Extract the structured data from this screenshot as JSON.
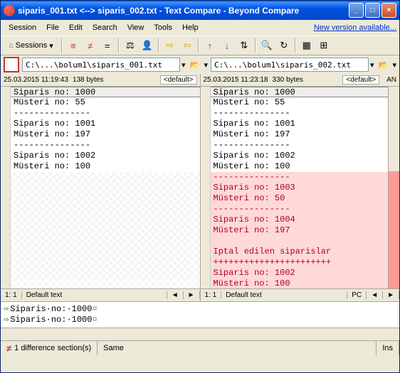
{
  "title": "siparis_001.txt <--> siparis_002.txt - Text Compare - Beyond Compare",
  "menu": [
    "Session",
    "File",
    "Edit",
    "Search",
    "View",
    "Tools",
    "Help"
  ],
  "new_version": "New version available...",
  "sessions_label": "Sessions",
  "left": {
    "path": "C:\\...\\bolum1\\siparis_001.txt",
    "date": "25.03.2015 11:19:43",
    "size": "138 bytes",
    "default": "<default>",
    "lines": [
      "Siparis no: 1000",
      "Müsteri no: 55",
      "---------------",
      "Siparis no: 1001",
      "Müsteri no: 197",
      "---------------",
      "Siparis no: 1002",
      "Müsteri no: 100"
    ],
    "cursor": "1: 1",
    "encoding": "Default text"
  },
  "right": {
    "path": "C:\\...\\bolum1\\siparis_002.txt",
    "date": "25.03.2015 11:23:18",
    "size": "330 bytes",
    "default": "<default>",
    "an": "AN",
    "lines_same": [
      "Siparis no: 1000",
      "Müsteri no: 55",
      "---------------",
      "Siparis no: 1001",
      "Müsteri no: 197",
      "---------------",
      "Siparis no: 1002",
      "Müsteri no: 100"
    ],
    "lines_diff": [
      "---------------",
      "Siparis no: 1003",
      "Müsteri no: 50",
      "---------------",
      "Siparis no: 1004",
      "Müsteri no: 197",
      "",
      "Iptal edilen siparislar",
      "+++++++++++++++++++++++",
      "Siparis no: 1002",
      "Müsteri no: 100"
    ],
    "cursor": "1: 1",
    "encoding": "Default text",
    "lineend": "PC"
  },
  "linked": {
    "l1": "Siparis·no:·1000",
    "l2": "Siparis·no:·1000"
  },
  "status": {
    "diff": "1 difference section(s)",
    "same": "Same",
    "ins": "Ins"
  }
}
